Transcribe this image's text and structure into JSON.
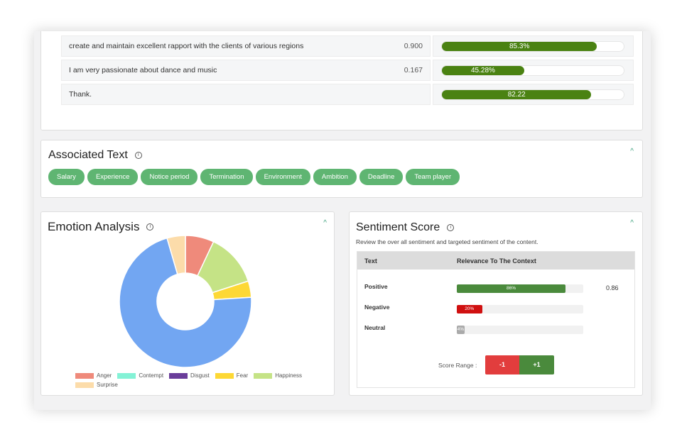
{
  "relevance_rows": [
    {
      "text": "create and maintain excellent rapport with the clients of various regions",
      "score": "0.900",
      "bar_label": "85.3%",
      "bar_percent": 85.3
    },
    {
      "text": "I am very passionate about dance and music",
      "score": "0.167",
      "bar_label": "45.28%",
      "bar_percent": 45.28
    },
    {
      "text": "Thank.",
      "score": "",
      "bar_label": "82.22",
      "bar_percent": 82.22
    }
  ],
  "associated": {
    "title": "Associated Text",
    "tags": [
      "Salary",
      "Experience",
      "Notice period",
      "Termination",
      "Environment",
      "Ambition",
      "Deadline",
      "Team player"
    ]
  },
  "emotion": {
    "title": "Emotion Analysis"
  },
  "chart_data": {
    "type": "pie",
    "title": "Emotion Analysis",
    "donut": true,
    "legend_position": "bottom",
    "slices": [
      {
        "label": "Anger",
        "value": 7,
        "color": "#ef8a7b",
        "in_legend": true
      },
      {
        "label": "Contempt",
        "value": 0,
        "color": "#84f2d6",
        "in_legend": true
      },
      {
        "label": "Disgust",
        "value": 0,
        "color": "#6a3d9a",
        "in_legend": true
      },
      {
        "label": "Happiness",
        "value": 13,
        "color": "#c5e386",
        "in_legend": true
      },
      {
        "label": "Fear",
        "value": 4,
        "color": "#fdd835",
        "in_legend": true
      },
      {
        "label": "(unlabeled)",
        "value": 71.5,
        "color": "#72a6f2",
        "in_legend": false
      },
      {
        "label": "Surprise",
        "value": 4.5,
        "color": "#fcdcaa",
        "in_legend": true
      }
    ],
    "legend_order": [
      "Anger",
      "Contempt",
      "Disgust",
      "Fear",
      "Happiness",
      "Surprise"
    ]
  },
  "sentiment": {
    "title": "Sentiment Score",
    "subtitle": "Review the over all sentiment and targeted sentiment of the content.",
    "col_text": "Text",
    "col_relevance": "Relevance To The Context",
    "rows": [
      {
        "label": "Positive",
        "bar_label": "86%",
        "percent": 86,
        "color": "#4a8a3c",
        "value": "0.86"
      },
      {
        "label": "Negative",
        "bar_label": "20%",
        "percent": 20,
        "color": "#d01010",
        "value": ""
      },
      {
        "label": "Neutral",
        "bar_label": "4%",
        "percent": 4,
        "color": "#aaaaaa",
        "value": ""
      }
    ],
    "score_range_label": "Score Range :",
    "range_min": "-1",
    "range_max": "+1",
    "colors": {
      "min": "#e23d3d",
      "max": "#4a8a3c"
    }
  }
}
